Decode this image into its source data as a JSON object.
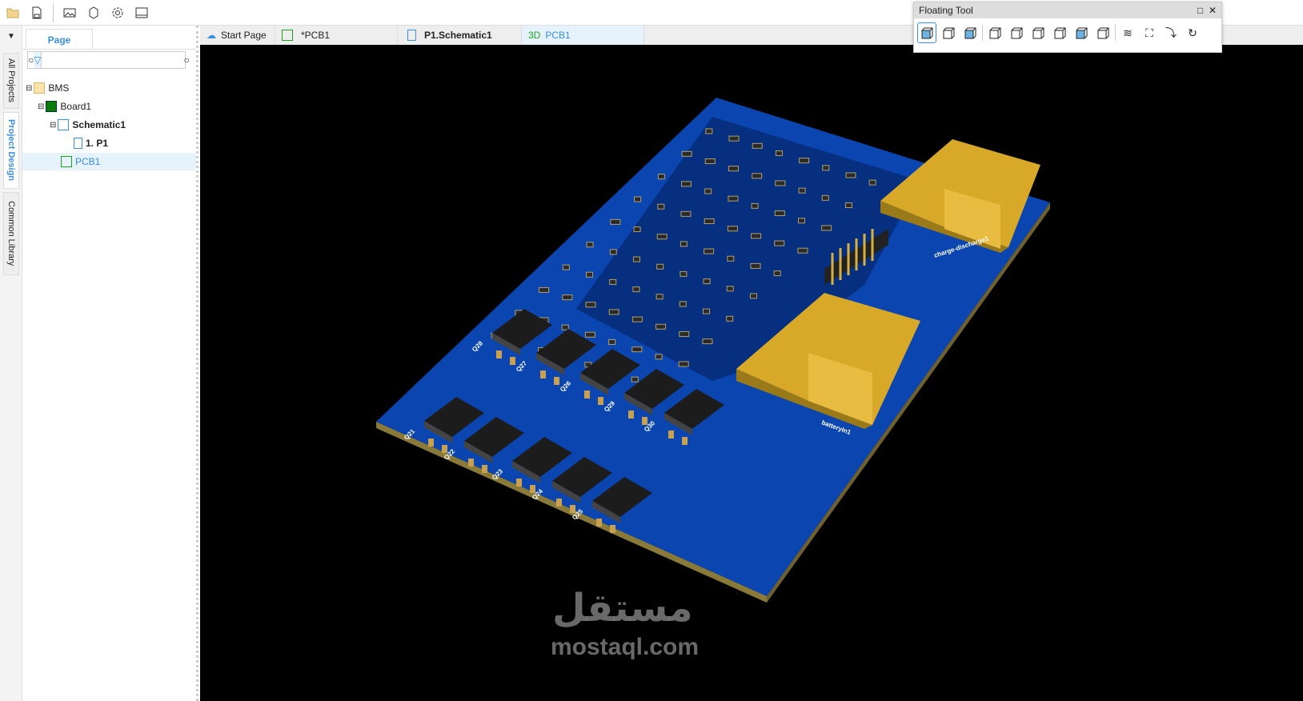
{
  "toolbar": {
    "icons": [
      "folder-icon",
      "save-icon",
      "image-export-icon",
      "3d-package-icon",
      "gear-icon",
      "panel-icon"
    ]
  },
  "left_tabs": {
    "pin": "pin-icon",
    "all_projects": "All Projects",
    "project_design": "Project Design",
    "common_library": "Common Library"
  },
  "panel": {
    "tab": "Page",
    "search_placeholder": "",
    "tree": [
      {
        "label": "BMS",
        "icon": "folder-icon"
      },
      {
        "label": "Board1",
        "icon": "board-icon"
      },
      {
        "label": "Schematic1",
        "icon": "schematic-icon"
      },
      {
        "label": "1. P1",
        "icon": "page-icon"
      },
      {
        "label": "PCB1",
        "icon": "pcb-icon"
      }
    ]
  },
  "tabs": [
    {
      "label": "Start Page",
      "icon": "cloud-icon"
    },
    {
      "label": "*PCB1",
      "icon": "pcb-icon"
    },
    {
      "label": "P1.Schematic1",
      "icon": "page-icon"
    },
    {
      "prefix": "3D",
      "label": "PCB1"
    }
  ],
  "floating_tool": {
    "title": "Floating Tool",
    "icons": [
      "solid-view-icon",
      "wireframe-view-icon",
      "textured-view-icon",
      "top-view-icon",
      "bottom-view-icon",
      "left-view-icon",
      "right-view-icon",
      "front-view-icon",
      "back-view-icon",
      "layers-icon",
      "fullscreen-icon",
      "export-icon",
      "rotate-icon"
    ]
  },
  "board": {
    "labels": {
      "conn1": "charge-discharge1",
      "conn2": "batteryIn1",
      "mosfets": [
        "Q21",
        "Q22",
        "Q23",
        "Q24",
        "Q25",
        "Q26",
        "Q27",
        "Q28",
        "Q29",
        "Q30"
      ]
    },
    "colors": {
      "board": "#0a3fa0",
      "connector": "#d4a020"
    }
  },
  "watermark": {
    "arabic": "مستقل",
    "latin": "mostaql.com"
  },
  "colors": {
    "accent": "#3a8ee6",
    "green": "#1aa31a"
  }
}
